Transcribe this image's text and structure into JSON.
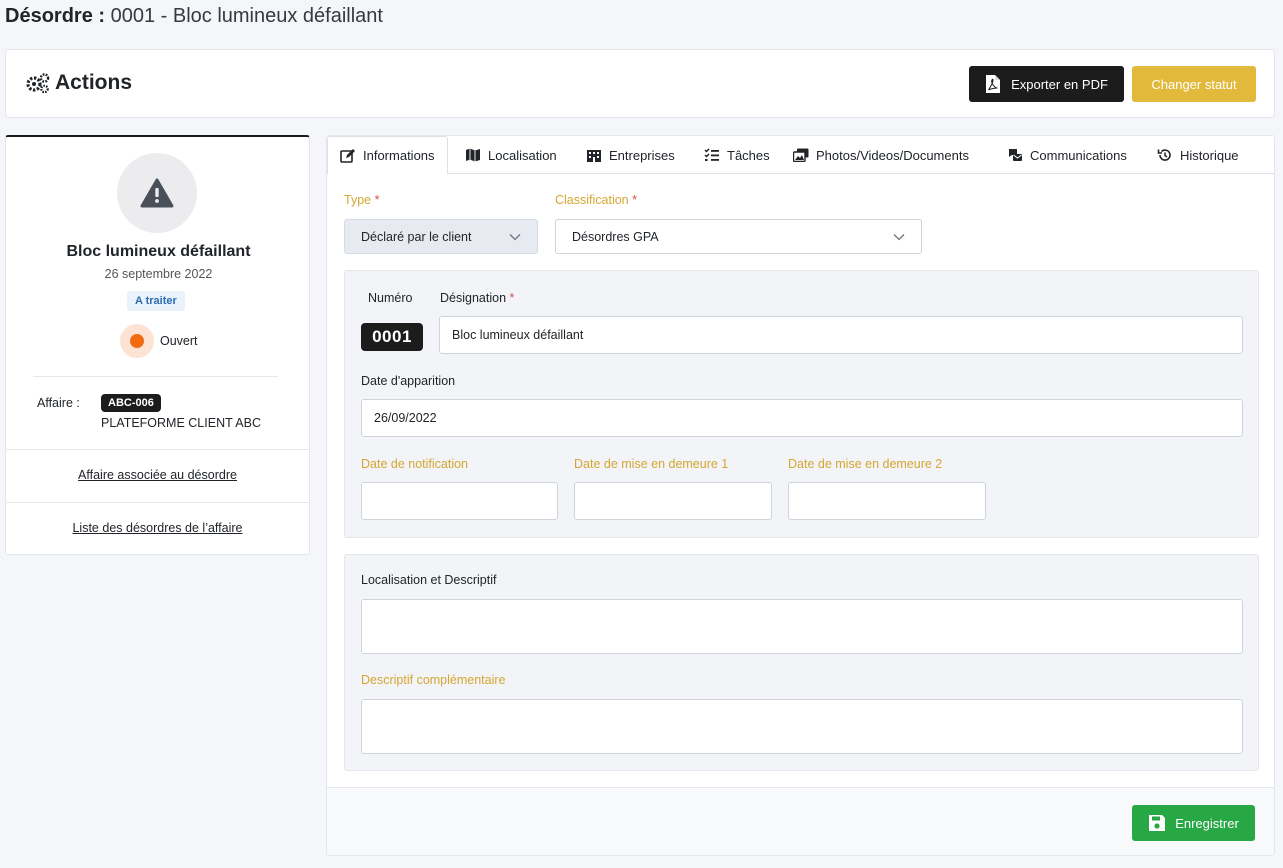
{
  "page": {
    "title_label": "Désordre :",
    "title_value": "0001 - Bloc lumineux défaillant"
  },
  "actions": {
    "title": "Actions",
    "export_pdf_label": "Exporter en PDF",
    "change_status_label": "Changer statut"
  },
  "summary": {
    "name": "Bloc lumineux défaillant",
    "date": "26 septembre 2022",
    "status_badge": "A traiter",
    "state": "Ouvert",
    "affaire_label": "Affaire :",
    "affaire_code": "ABC-006",
    "affaire_client": "PLATEFORME CLIENT ABC",
    "link_affaire": "Affaire associée au désordre",
    "link_list": "Liste des désordres de l’affaire"
  },
  "tabs": [
    {
      "label": "Informations",
      "icon": "edit-icon"
    },
    {
      "label": "Localisation",
      "icon": "map-icon"
    },
    {
      "label": "Entreprises",
      "icon": "building-icon"
    },
    {
      "label": "Tâches",
      "icon": "tasks-icon"
    },
    {
      "label": "Photos/Videos/Documents",
      "icon": "photos-icon"
    },
    {
      "label": "Communications",
      "icon": "communications-icon"
    },
    {
      "label": "Historique",
      "icon": "history-icon"
    }
  ],
  "form": {
    "type_label": "Type",
    "type_value": "Déclaré par le client",
    "classification_label": "Classification",
    "classification_value": "Désordres GPA",
    "required_mark": "*",
    "numero_label": "Numéro",
    "numero_value": "0001",
    "designation_label": "Désignation",
    "designation_value": "Bloc lumineux défaillant",
    "date_apparition_label": "Date d'apparition",
    "date_apparition_value": "26/09/2022",
    "date_notification_label": "Date de notification",
    "date_demeure1_label": "Date de mise en demeure 1",
    "date_demeure2_label": "Date de mise en demeure 2",
    "localisation_label": "Localisation et Descriptif",
    "descriptif_label": "Descriptif complémentaire"
  },
  "footer": {
    "save_label": "Enregistrer"
  },
  "colors": {
    "accent_gold": "#e2b93b",
    "dark": "#1c1c1c",
    "success": "#28a745",
    "open_orange": "#f26b11"
  }
}
